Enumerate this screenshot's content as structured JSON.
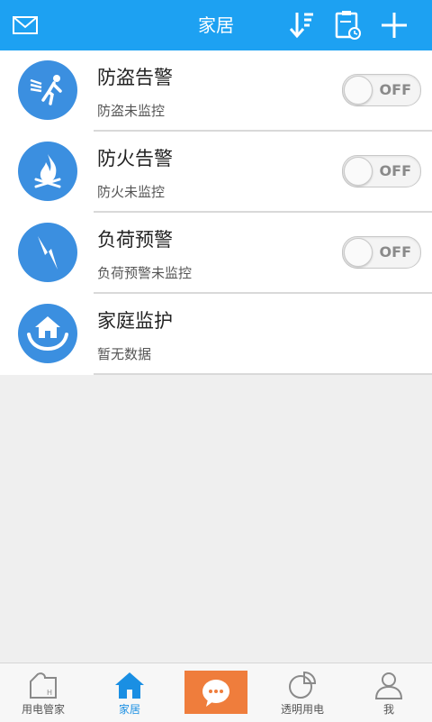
{
  "header": {
    "title": "家居",
    "left_icon": "mail-icon",
    "right_icons": [
      "sort-icon",
      "schedule-icon",
      "add-icon"
    ],
    "bg_color": "#1da1f2"
  },
  "items": [
    {
      "name": "防盗告警",
      "status": "防盗未监控",
      "icon": "burglar-alarm-icon",
      "toggle": "OFF"
    },
    {
      "name": "防火告警",
      "status": "防火未监控",
      "icon": "fire-alarm-icon",
      "toggle": "OFF"
    },
    {
      "name": "负荷预警",
      "status": "负荷预警未监控",
      "icon": "lightning-icon",
      "toggle": "OFF"
    },
    {
      "name": "家庭监护",
      "status": "暂无数据",
      "icon": "home-care-icon"
    }
  ],
  "tabs": [
    {
      "label": "用电管家",
      "icon": "electric-housekeeper-icon"
    },
    {
      "label": "家居",
      "icon": "home-icon",
      "active": true
    },
    {
      "label": "",
      "icon": "chat-icon"
    },
    {
      "label": "透明用电",
      "icon": "pie-chart-icon"
    },
    {
      "label": "我",
      "icon": "user-icon"
    }
  ],
  "colors": {
    "accent": "#1da1f2",
    "icon_bg": "#3b8fe0",
    "center_btn": "#ef7d3c"
  }
}
